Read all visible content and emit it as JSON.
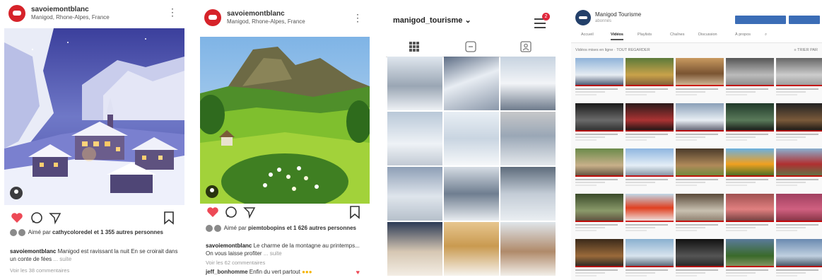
{
  "post1": {
    "account": "savoiemontblanc",
    "location": "Manigod, Rhone-Alpes, France",
    "liked_by_prefix": "Aimé par",
    "liked_by_user": "cathycoloredel",
    "liked_by_rest": "et 1 355 autres personnes",
    "caption_user": "savoiemontblanc",
    "caption_text": "Manigod est ravissant la nuit",
    "caption_text2": "En se croirait dans un conte de fées",
    "caption_more": "... suite",
    "comments_link": "Voir les 38 commentaires"
  },
  "post2": {
    "account": "savoiemontblanc",
    "location": "Manigod, Rhone-Alpes, France",
    "liked_by_prefix": "Aimé par",
    "liked_by_user": "piemtobopins",
    "liked_by_rest": "et 1 626 autres personnes",
    "caption_user": "savoiemontblanc",
    "caption_text": "Le charme de la montagne au printemps... On vous laisse profiter",
    "caption_more": "... suite",
    "comments_link": "Voir les 62 commentaires",
    "reply_user": "jeff_bonhomme",
    "reply_text": "Enfin du vert partout"
  },
  "profile": {
    "username": "manigod_tourisme",
    "dropdown_glyph": "⌄",
    "notification_count": "2"
  },
  "youtube": {
    "channel_name": "Manigod Tourisme",
    "subscribers": "abonnés",
    "tabs": [
      "Accueil",
      "Vidéos",
      "Playlists",
      "Chaînes",
      "Discussion",
      "À propos"
    ],
    "active_tab": 1,
    "filter_label": "Vidéos mises en ligne · TOUT REGARDER",
    "sort_label": "≡ TRIER PAR"
  },
  "colors": {
    "instagram_like": "#ed4956",
    "brand_red": "#d6232a",
    "youtube_blue": "#3b6db6"
  }
}
